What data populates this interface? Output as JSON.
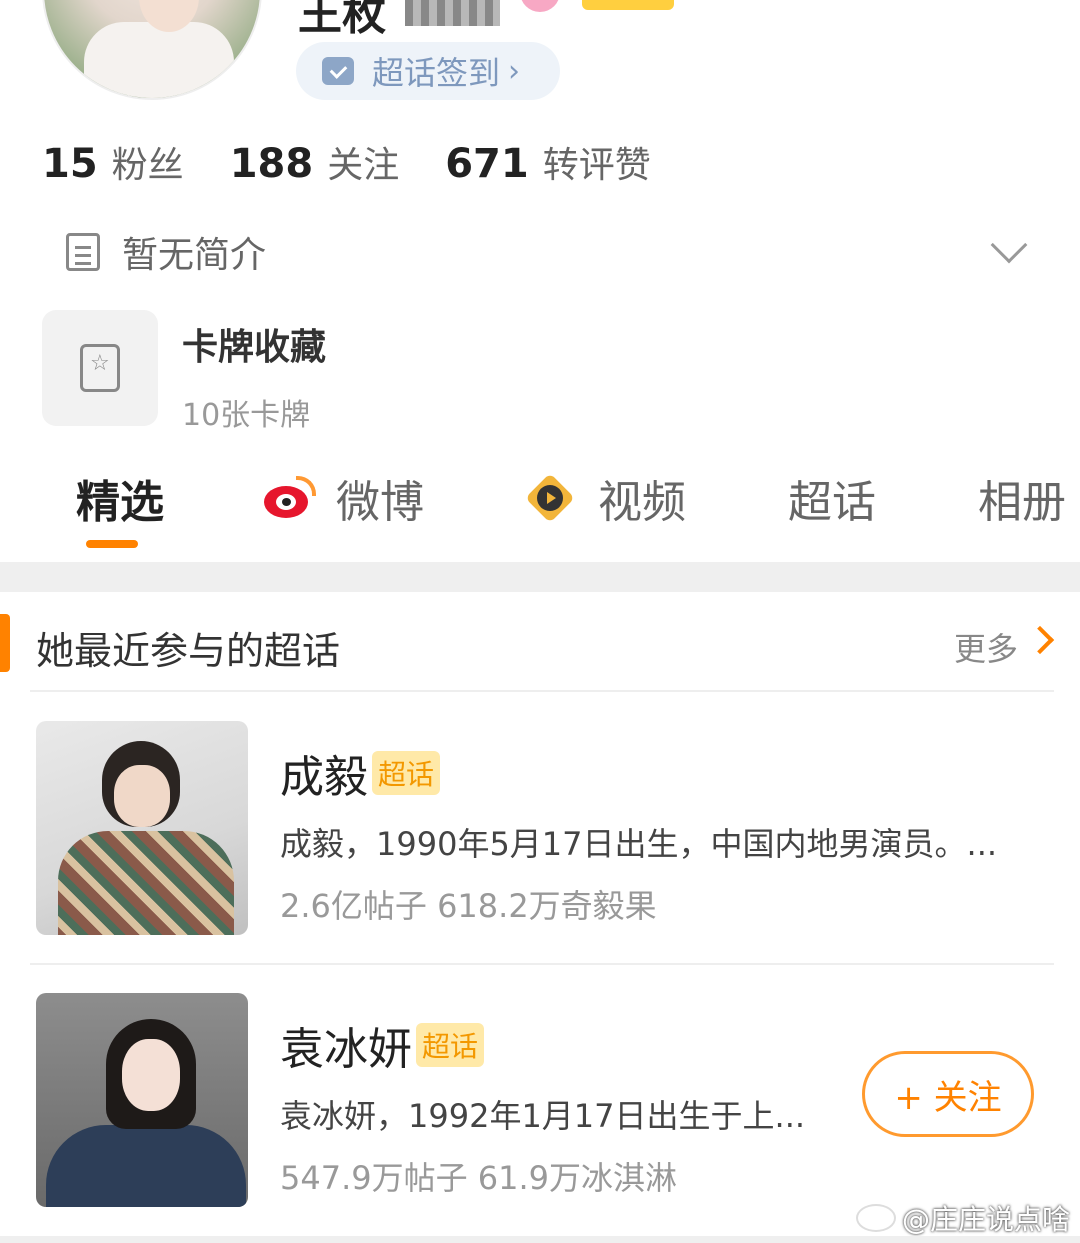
{
  "profile": {
    "name": "王枚",
    "checkin_label": "超话签到",
    "checkin_chevron": "›"
  },
  "stats": [
    {
      "num": "15",
      "label": "粉丝"
    },
    {
      "num": "188",
      "label": "关注"
    },
    {
      "num": "671",
      "label": "转评赞"
    }
  ],
  "bio": {
    "text": "暂无简介"
  },
  "card_collection": {
    "title": "卡牌收藏",
    "subtitle": "10张卡牌"
  },
  "tabs": [
    {
      "label": "精选",
      "active": true
    },
    {
      "label": "微博",
      "icon": "weibo-icon"
    },
    {
      "label": "视频",
      "icon": "video-icon"
    },
    {
      "label": "超话"
    },
    {
      "label": "相册"
    }
  ],
  "section": {
    "title": "她最近参与的超话",
    "more": "更多"
  },
  "topics": [
    {
      "name": "成毅",
      "tag": "超话",
      "desc": "成毅，1990年5月17日出生，中国内地男演员。...",
      "stats": "2.6亿帖子 618.2万奇毅果"
    },
    {
      "name": "袁冰妍",
      "tag": "超话",
      "desc": "袁冰妍，1992年1月17日出生于上...",
      "stats": "547.9万帖子 61.9万冰淇淋",
      "follow_label": "+ 关注"
    }
  ],
  "watermark": "@庄庄说点啥",
  "colors": {
    "accent": "#ff8200",
    "checkin_text": "#7e98bd",
    "tag_bg": "#ffe9a8"
  }
}
